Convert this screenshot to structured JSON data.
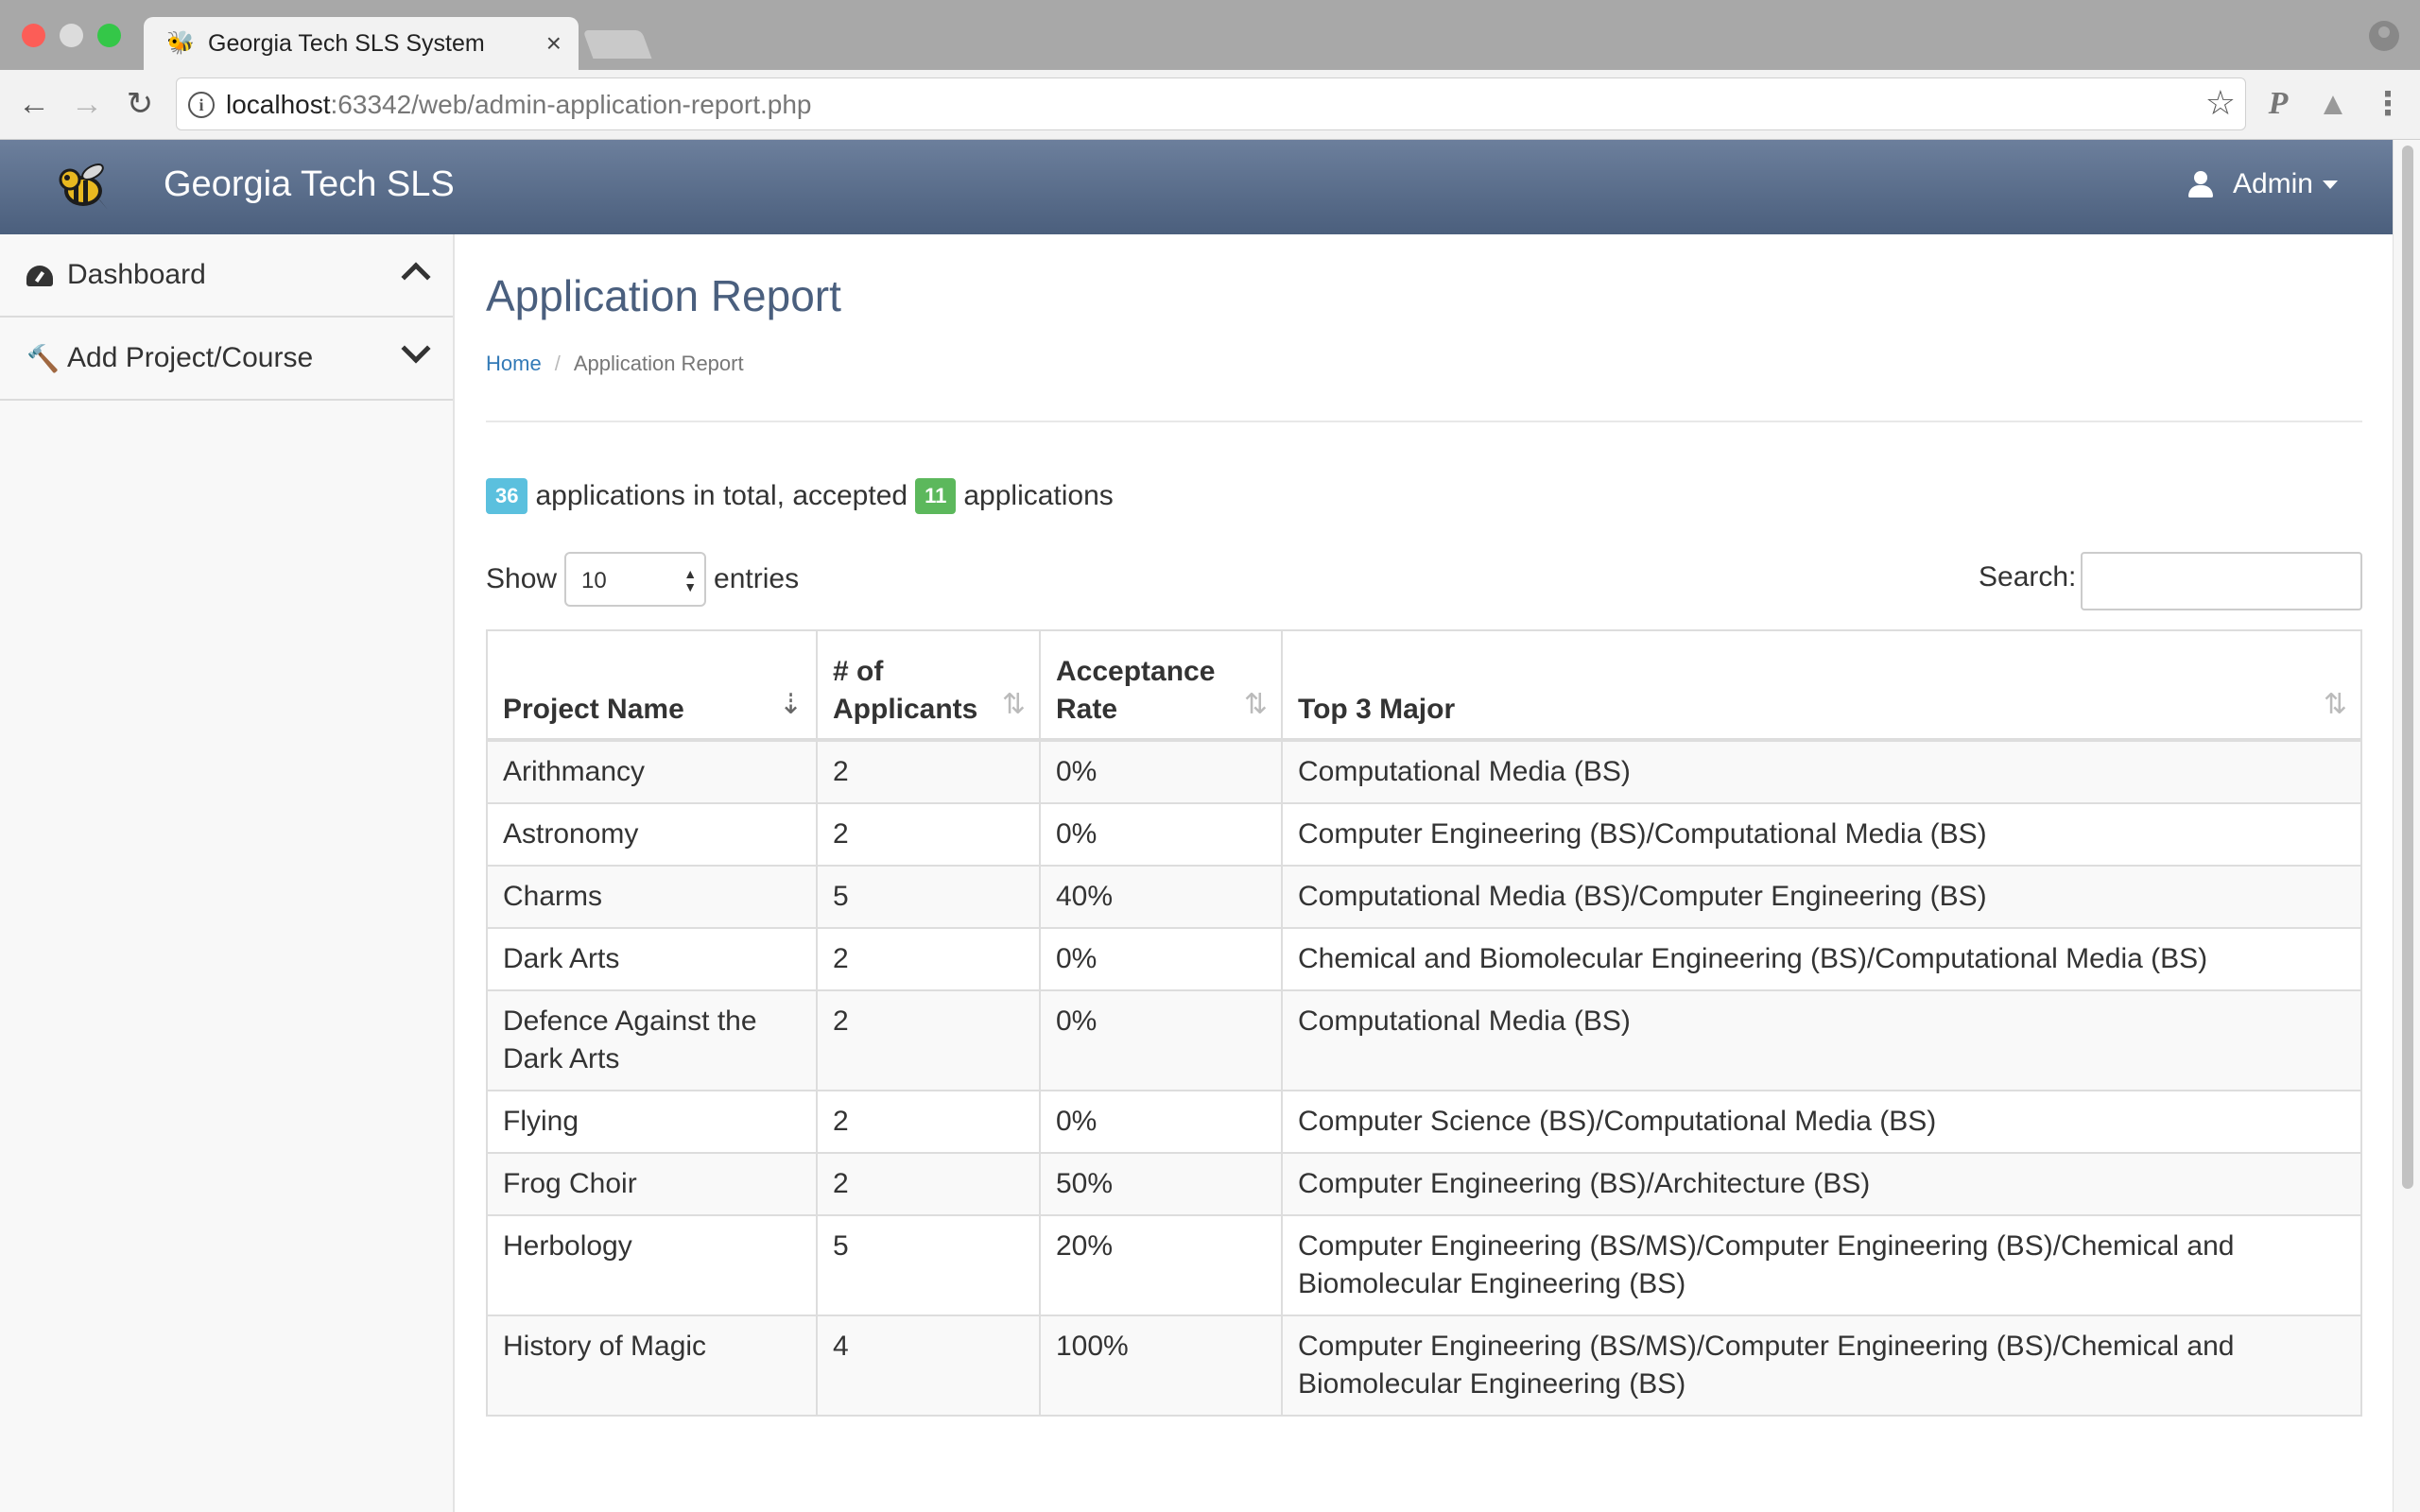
{
  "browser": {
    "tab_title": "Georgia Tech SLS System",
    "tab_close": "×",
    "url_host": "localhost",
    "url_rest": ":63342/web/admin-application-report.php"
  },
  "header": {
    "brand": "Georgia Tech SLS",
    "user": "Admin"
  },
  "sidebar": {
    "items": [
      {
        "label": "Dashboard",
        "icon": "dashboard-icon",
        "chevron": "chevron-up-icon"
      },
      {
        "label": "Add Project/Course",
        "icon": "gavel-icon",
        "chevron": "chevron-down-icon"
      }
    ]
  },
  "page": {
    "title": "Application Report",
    "breadcrumb": {
      "home": "Home",
      "separator": "/",
      "current": "Application Report"
    }
  },
  "summary": {
    "total": "36",
    "text1": "applications in total, accepted",
    "accepted": "11",
    "text2": "applications"
  },
  "controls": {
    "show_label": "Show",
    "entries_value": "10",
    "entries_label": "entries",
    "search_label": "Search:",
    "search_value": ""
  },
  "table": {
    "headers": [
      "Project Name",
      "# of Applicants",
      "Acceptance Rate",
      "Top 3 Major"
    ],
    "rows": [
      [
        "Arithmancy",
        "2",
        "0%",
        "Computational Media (BS)"
      ],
      [
        "Astronomy",
        "2",
        "0%",
        "Computer Engineering (BS)/Computational Media (BS)"
      ],
      [
        "Charms",
        "5",
        "40%",
        "Computational Media (BS)/Computer Engineering (BS)"
      ],
      [
        "Dark Arts",
        "2",
        "0%",
        "Chemical and Biomolecular Engineering (BS)/Computational Media (BS)"
      ],
      [
        "Defence Against the Dark Arts",
        "2",
        "0%",
        "Computational Media (BS)"
      ],
      [
        "Flying",
        "2",
        "0%",
        "Computer Science (BS)/Computational Media (BS)"
      ],
      [
        "Frog Choir",
        "2",
        "50%",
        "Computer Engineering (BS)/Architecture (BS)"
      ],
      [
        "Herbology",
        "5",
        "20%",
        "Computer Engineering (BS/MS)/Computer Engineering (BS)/Chemical and Biomolecular Engineering (BS)"
      ],
      [
        "History of Magic",
        "4",
        "100%",
        "Computer Engineering (BS/MS)/Computer Engineering (BS)/Chemical and Biomolecular Engineering (BS)"
      ]
    ]
  },
  "colors": {
    "header_top": "#6c7f9c",
    "header_bottom": "#4b5f7d",
    "title": "#4a5f7e",
    "link": "#337ab7",
    "badge_info": "#5bc0de",
    "badge_success": "#5cb85c"
  }
}
